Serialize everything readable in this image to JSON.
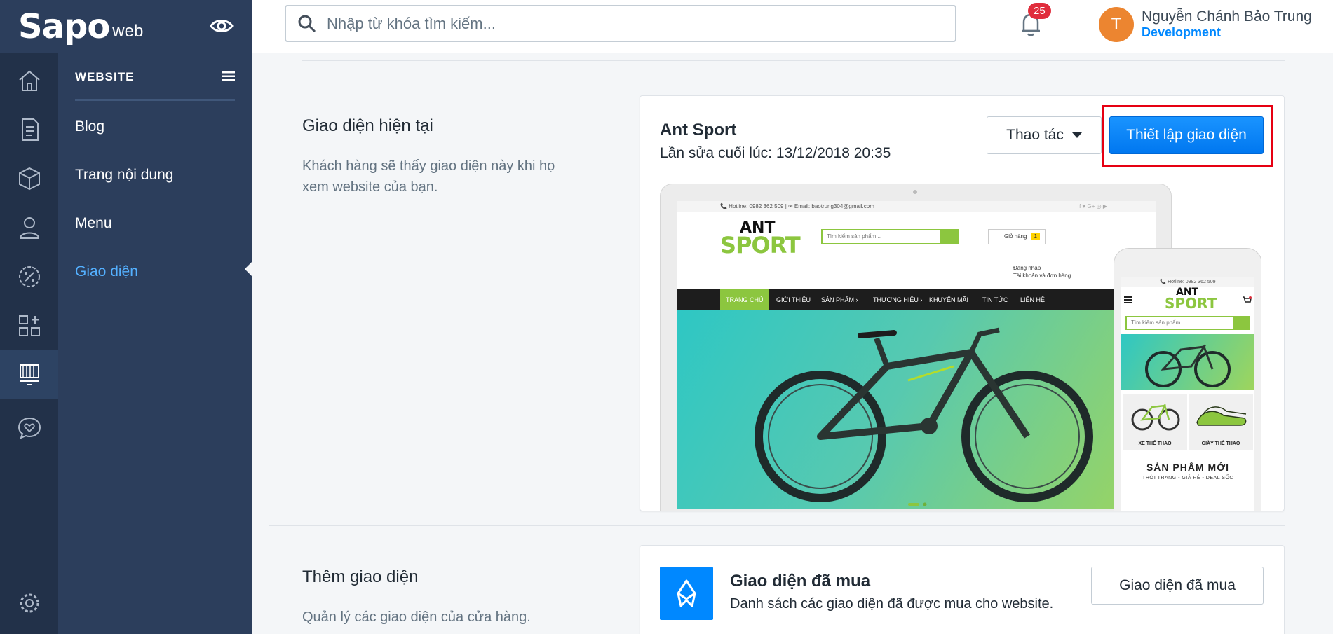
{
  "brand": {
    "logo": "Sapo",
    "sub": "web"
  },
  "search": {
    "placeholder": "Nhập từ khóa tìm kiếm..."
  },
  "notifications": {
    "count": "25"
  },
  "user": {
    "initial": "T",
    "name": "Nguyễn Chánh Bảo Trung",
    "role": "Development"
  },
  "submenu": {
    "title": "WEBSITE",
    "items": [
      {
        "label": "Blog"
      },
      {
        "label": "Trang nội dung"
      },
      {
        "label": "Menu"
      },
      {
        "label": "Giao diện"
      }
    ]
  },
  "current_theme": {
    "section_title": "Giao diện hiện tại",
    "section_desc": "Khách hàng sẽ thấy giao diện này khi họ xem website của bạn.",
    "name": "Ant Sport",
    "edited": "Lần sửa cuối lúc: 13/12/2018 20:35",
    "actions_label": "Thao tác",
    "customize_label": "Thiết lập giao diện"
  },
  "preview": {
    "hotline": "📞 Hotline: 0982 362 509  |  ✉ Email: baotrung304@gmail.com",
    "social": "f  ♥  G+  ◎  ▶",
    "logo_top": "ANT",
    "logo_bottom": "SPORT",
    "search_placeholder": "Tìm kiếm sản phẩm...",
    "cart": "Giỏ hàng",
    "cart_count": "1",
    "login": "Đăng nhập",
    "account": "Tài khoản và đơn hàng",
    "nav": [
      "TRANG CHỦ",
      "GIỚI THIỆU",
      "SẢN PHẨM ›",
      "THƯƠNG HIỆU ›",
      "KHUYẾN MÃI",
      "TIN TỨC",
      "LIÊN HỆ"
    ],
    "mobile_hotline": "📞 Hotline: 0982 362 509",
    "mobile_tile_1": "XE THỂ THAO",
    "mobile_tile_2": "GIÀY THỂ THAO",
    "mobile_new": "SẢN PHẨM MỚI",
    "mobile_new_sub": "THỜI TRANG - GIÁ RẺ - DEAL SỐC"
  },
  "add_theme": {
    "section_title": "Thêm giao diện",
    "section_desc": "Quản lý các giao diện của cửa hàng.",
    "bought_title": "Giao diện đã mua",
    "bought_desc": "Danh sách các giao diện đã được mua cho website.",
    "bought_button": "Giao diện đã mua"
  },
  "colors": {
    "sidebar": "#2c3e5c",
    "rail": "#223149",
    "accent": "#0088ff",
    "highlight": "#e60012",
    "theme_green": "#8cc63f"
  },
  "icons": {
    "rail": [
      "home-icon",
      "order-icon",
      "product-icon",
      "customer-icon",
      "discount-icon",
      "apps-icon",
      "website-icon",
      "support-icon",
      "settings-icon"
    ]
  }
}
